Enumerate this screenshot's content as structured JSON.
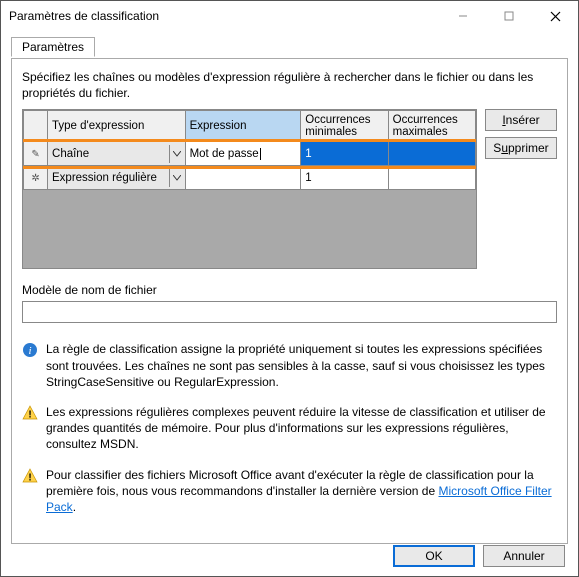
{
  "window": {
    "title": "Paramètres de classification"
  },
  "tab_label": "Paramètres",
  "intro": "Spécifiez les chaînes ou modèles d'expression régulière à rechercher dans le fichier ou dans les propriétés du fichier.",
  "columns": {
    "type": "Type d'expression",
    "expr": "Expression",
    "min": "Occurrences minimales",
    "max": "Occurrences maximales"
  },
  "rows": [
    {
      "type": "Chaîne",
      "expr": "Mot de passe",
      "min": "1",
      "max": "",
      "selected": true,
      "editing": true
    },
    {
      "type": "Expression régulière",
      "expr": "",
      "min": "1",
      "max": "",
      "selected": false,
      "editing": false
    }
  ],
  "buttons": {
    "insert": "Insérer",
    "delete": "Supprimer",
    "ok": "OK",
    "cancel": "Annuler"
  },
  "filename_model": {
    "label": "Modèle de nom de fichier",
    "value": ""
  },
  "notes": {
    "info": "La règle de classification assigne la propriété uniquement si toutes les expressions spécifiées sont trouvées. Les chaînes ne sont pas sensibles à la casse, sauf si vous choisissez les types StringCaseSensitive ou RegularExpression.",
    "warn1": "Les expressions régulières complexes peuvent réduire la vitesse de classification et utiliser de grandes quantités de mémoire. Pour plus d'informations sur les expressions régulières, consultez MSDN.",
    "warn2_a": "Pour classifier des fichiers Microsoft Office avant d'exécuter la règle de classification pour la première fois, nous vous recommandons d'installer la dernière version de ",
    "warn2_link": "Microsoft Office Filter Pack",
    "warn2_b": "."
  }
}
